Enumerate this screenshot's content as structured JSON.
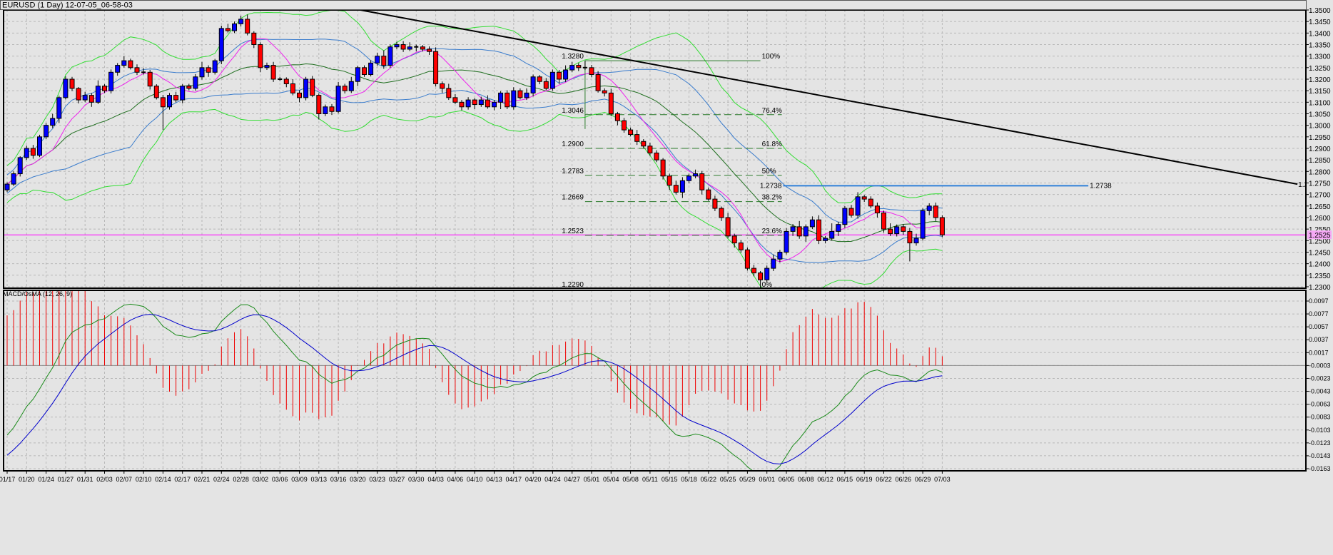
{
  "window": {
    "title": "EURUSD (1 Day) 12-07-05_06-58-03"
  },
  "colors": {
    "background": "#e4e4e4",
    "bull_candle": "#0000ff",
    "bear_candle": "#ff0000",
    "bb_outer": "#33dd33",
    "bb_inner": "#3a7ccc",
    "fast_ma": "#ee22ee",
    "mid_ma": "#1f6e1f",
    "macd_line": "#1a8a1a",
    "signal_line": "#0000cc",
    "osma_hist": "#ee0000",
    "trendline": "#000000",
    "fib": "#2a7a2a",
    "level_blue": "#2f7fd8",
    "level_magenta": "#ff00ff"
  },
  "chart_data": [
    {
      "type": "candlestick",
      "symbol": "EURUSD",
      "timeframe": "1 Day",
      "bars_per_label": 3,
      "x_labels": [
        "01/17",
        "01/20",
        "01/24",
        "01/27",
        "01/31",
        "02/03",
        "02/07",
        "02/10",
        "02/14",
        "02/17",
        "02/21",
        "02/24",
        "02/28",
        "03/02",
        "03/06",
        "03/09",
        "03/13",
        "03/16",
        "03/20",
        "03/23",
        "03/27",
        "03/30",
        "04/03",
        "04/06",
        "04/10",
        "04/13",
        "04/17",
        "04/20",
        "04/24",
        "04/27",
        "05/01",
        "05/04",
        "05/08",
        "05/11",
        "05/15",
        "05/18",
        "05/22",
        "05/25",
        "05/29",
        "06/01",
        "06/05",
        "06/08",
        "06/12",
        "06/15",
        "06/19",
        "06/22",
        "06/26",
        "06/29",
        "07/03"
      ],
      "ylim": [
        1.23,
        1.35
      ],
      "y_ticks": [
        "1.3500",
        "1.3450",
        "1.3400",
        "1.3350",
        "1.3300",
        "1.3250",
        "1.3200",
        "1.3150",
        "1.3100",
        "1.3050",
        "1.3000",
        "1.2950",
        "1.2900",
        "1.2850",
        "1.2800",
        "1.2750",
        "1.2700",
        "1.2650",
        "1.2600",
        "1.2550",
        "1.2500",
        "1.2450",
        "1.2400",
        "1.2350",
        "1.2300"
      ],
      "first_open": 1.272,
      "close": [
        1.2745,
        1.279,
        1.286,
        1.29,
        1.287,
        1.295,
        1.3,
        1.303,
        1.312,
        1.32,
        1.316,
        1.311,
        1.313,
        1.31,
        1.317,
        1.315,
        1.323,
        1.326,
        1.328,
        1.325,
        1.323,
        1.323,
        1.317,
        1.312,
        1.308,
        1.313,
        1.311,
        1.317,
        1.316,
        1.321,
        1.325,
        1.323,
        1.328,
        1.342,
        1.341,
        1.344,
        1.346,
        1.34,
        1.335,
        1.325,
        1.326,
        1.32,
        1.32,
        1.318,
        1.314,
        1.312,
        1.32,
        1.313,
        1.305,
        1.308,
        1.306,
        1.317,
        1.315,
        1.319,
        1.325,
        1.322,
        1.327,
        1.33,
        1.326,
        1.334,
        1.335,
        1.333,
        1.334,
        1.334,
        1.333,
        1.332,
        1.318,
        1.316,
        1.312,
        1.31,
        1.308,
        1.311,
        1.309,
        1.311,
        1.308,
        1.31,
        1.314,
        1.308,
        1.315,
        1.312,
        1.314,
        1.321,
        1.319,
        1.316,
        1.323,
        1.32,
        1.324,
        1.326,
        1.325,
        1.325,
        1.322,
        1.315,
        1.314,
        1.305,
        1.302,
        1.298,
        1.296,
        1.293,
        1.291,
        1.288,
        1.285,
        1.278,
        1.274,
        1.271,
        1.276,
        1.278,
        1.279,
        1.272,
        1.268,
        1.264,
        1.26,
        1.252,
        1.249,
        1.246,
        1.238,
        1.236,
        1.233,
        1.238,
        1.242,
        1.245,
        1.254,
        1.256,
        1.252,
        1.256,
        1.259,
        1.25,
        1.251,
        1.254,
        1.257,
        1.264,
        1.261,
        1.269,
        1.268,
        1.265,
        1.262,
        1.255,
        1.253,
        1.256,
        1.254,
        1.249,
        1.251,
        1.263,
        1.265,
        1.26,
        1.2525
      ],
      "upper_wick_pips": [
        8,
        10,
        6,
        12,
        15,
        9,
        10,
        20,
        8,
        12,
        10,
        6,
        15,
        10,
        25,
        8,
        12,
        10,
        20,
        9,
        14,
        18,
        10,
        8,
        12,
        10,
        15,
        8,
        10,
        12,
        25,
        10,
        8,
        12,
        20,
        10,
        15,
        20,
        8,
        10,
        12,
        15,
        10,
        8,
        20,
        12,
        10,
        14,
        8,
        10,
        12,
        18,
        10,
        20,
        8,
        10,
        12,
        15,
        25,
        10,
        12,
        15,
        20,
        10,
        8,
        12,
        18,
        10,
        20,
        15,
        10,
        12,
        8,
        14,
        20,
        10,
        8,
        12,
        15,
        10,
        20,
        10,
        8,
        15,
        12,
        10,
        20,
        15,
        10,
        30,
        12,
        15,
        10,
        18,
        8,
        12,
        10,
        20,
        10,
        15,
        12,
        8,
        10,
        20,
        15,
        10,
        18,
        12,
        10,
        15,
        8,
        20,
        10,
        12,
        10,
        15,
        8,
        12,
        20,
        10,
        15,
        12,
        25,
        10,
        15,
        20,
        10,
        35,
        12,
        10,
        15,
        20,
        8,
        12,
        15,
        10,
        25,
        10,
        12,
        15,
        20,
        10,
        12,
        15,
        10
      ],
      "lower_wick_pips": [
        10,
        8,
        12,
        10,
        15,
        8,
        10,
        12,
        20,
        8,
        12,
        15,
        10,
        20,
        8,
        10,
        12,
        15,
        10,
        8,
        12,
        10,
        15,
        8,
        100,
        12,
        10,
        15,
        8,
        10,
        12,
        20,
        10,
        15,
        8,
        10,
        12,
        10,
        15,
        20,
        10,
        12,
        8,
        15,
        10,
        20,
        12,
        8,
        25,
        10,
        15,
        8,
        12,
        10,
        20,
        10,
        8,
        12,
        15,
        10,
        10,
        12,
        8,
        20,
        10,
        15,
        12,
        20,
        10,
        8,
        15,
        12,
        20,
        10,
        8,
        15,
        30,
        10,
        12,
        8,
        10,
        15,
        12,
        8,
        10,
        20,
        12,
        10,
        15,
        10,
        12,
        8,
        15,
        10,
        20,
        12,
        8,
        15,
        10,
        12,
        10,
        15,
        20,
        10,
        25,
        12,
        10,
        20,
        8,
        12,
        15,
        10,
        20,
        12,
        10,
        15,
        40,
        10,
        12,
        15,
        10,
        20,
        12,
        25,
        10,
        15,
        12,
        10,
        20,
        15,
        10,
        15,
        12,
        10,
        20,
        15,
        10,
        12,
        15,
        80,
        12,
        10,
        20,
        15,
        10
      ],
      "indicators": {
        "bollinger_outer": {
          "period": 20,
          "deviation": 2
        },
        "bollinger_inner": {
          "period": 20,
          "deviation": 1
        },
        "fast_ma_period": 8,
        "mid_ma_period": 20
      },
      "horizontal_lines": [
        {
          "value": 1.2525,
          "label": "1.2525",
          "color": "#ff00ff"
        },
        {
          "value": 1.2738,
          "label": "1.2738",
          "color": "#2f7fd8",
          "from_bar": 119.5,
          "to_bar": 166.5
        }
      ],
      "trendline": {
        "from_bar": 54.4,
        "from_price": 1.35,
        "to_bar": 198.7,
        "to_price": 1.2745,
        "label": "1.2"
      },
      "fibonacci": {
        "from_bar": 89,
        "to_bar": 116,
        "levels": [
          {
            "pct": "100%",
            "price": 1.328,
            "price_label": "1.3280",
            "style": "solid"
          },
          {
            "pct": "76.4%",
            "price": 1.3046,
            "price_label": "1.3046",
            "style": "dashed"
          },
          {
            "pct": "61.8%",
            "price": 1.29,
            "price_label": "1.2900",
            "style": "dashed"
          },
          {
            "pct": "50%",
            "price": 1.2783,
            "price_label": "1.2783",
            "style": "dashed"
          },
          {
            "pct": "38.2%",
            "price": 1.2669,
            "price_label": "1.2669",
            "style": "dashed"
          },
          {
            "pct": "23.6%",
            "price": 1.2523,
            "price_label": "1.2523",
            "style": "dashed"
          },
          {
            "pct": "0%",
            "price": 1.229,
            "price_label": "1.2290",
            "style": "solid"
          }
        ]
      }
    },
    {
      "type": "line",
      "title": "MACD/OsMA (12, 26, 9)",
      "fast": 12,
      "slow": 26,
      "signal": 9,
      "ylim": [
        -0.0163,
        0.0097
      ],
      "y_ticks": [
        "0.0097",
        "0.0077",
        "0.0057",
        "0.0037",
        "0.0017",
        "-0.0003",
        "-0.0023",
        "-0.0043",
        "-0.0063",
        "-0.0083",
        "-0.0103",
        "-0.0123",
        "-0.0143",
        "-0.0163"
      ],
      "baseline": -0.0003
    }
  ]
}
